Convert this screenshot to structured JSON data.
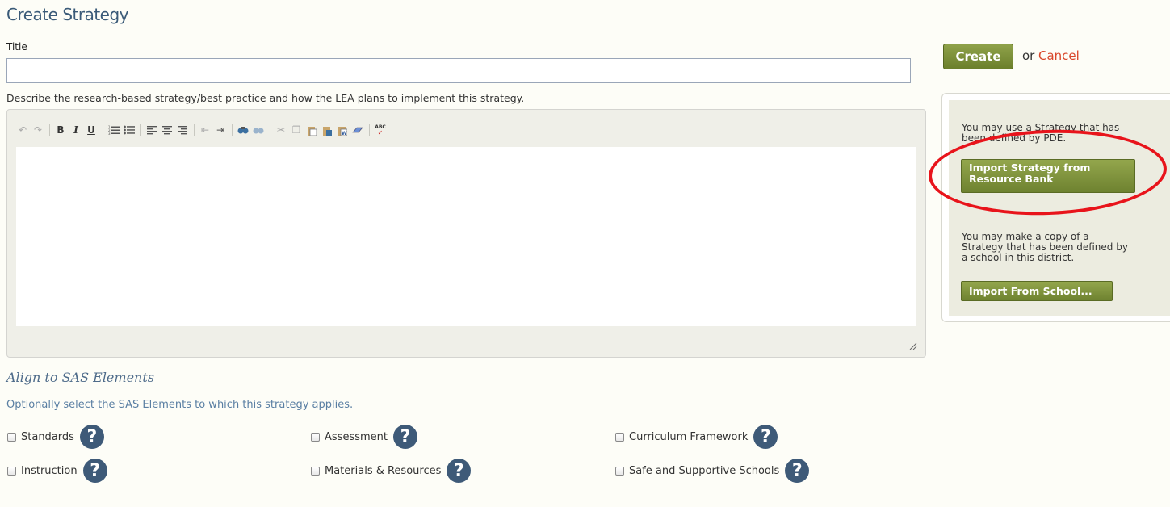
{
  "page": {
    "title": "Create Strategy"
  },
  "form": {
    "title_label": "Title",
    "title_value": "",
    "description_label": "Describe the research-based strategy/best practice and how the LEA plans to implement this strategy."
  },
  "toolbar": {
    "icons": [
      "undo-icon",
      "redo-icon",
      "bold-icon",
      "italic-icon",
      "underline-icon",
      "ordered-list-icon",
      "bullet-list-icon",
      "align-left-icon",
      "align-center-icon",
      "align-right-icon",
      "outdent-icon",
      "indent-icon",
      "find-icon",
      "replace-icon",
      "cut-icon",
      "copy-icon",
      "paste-icon",
      "paste-text-icon",
      "paste-word-icon",
      "eraser-icon",
      "spellcheck-icon"
    ],
    "bold": "B",
    "italic": "I",
    "underline": "U",
    "spellcheck": "ABC"
  },
  "sas": {
    "title": "Align to SAS Elements",
    "description": "Optionally select the SAS Elements to which this strategy applies.",
    "items": [
      {
        "label": "Standards",
        "checked": false
      },
      {
        "label": "Assessment",
        "checked": false
      },
      {
        "label": "Curriculum Framework",
        "checked": false
      },
      {
        "label": "Instruction",
        "checked": false
      },
      {
        "label": "Materials & Resources",
        "checked": false
      },
      {
        "label": "Safe and Supportive Schools",
        "checked": false
      }
    ],
    "help_glyph": "?"
  },
  "actions": {
    "create_label": "Create",
    "or_text": "or",
    "cancel_label": "Cancel"
  },
  "side": {
    "pde_text_1": "You may use a Strategy that has",
    "pde_text_2": "been defined by PDE.",
    "import_bank_1": "Import Strategy from",
    "import_bank_2": "Resource Bank",
    "school_text_1": "You may make a copy of a",
    "school_text_2": "Strategy that has been defined by",
    "school_text_3": "a school in this district.",
    "import_school_label": "Import From School..."
  },
  "colors": {
    "accent_olive": "#7a8d35",
    "link_red": "#d9472b",
    "heading_blue": "#3a5a78",
    "annotation_red": "#e8141b"
  }
}
